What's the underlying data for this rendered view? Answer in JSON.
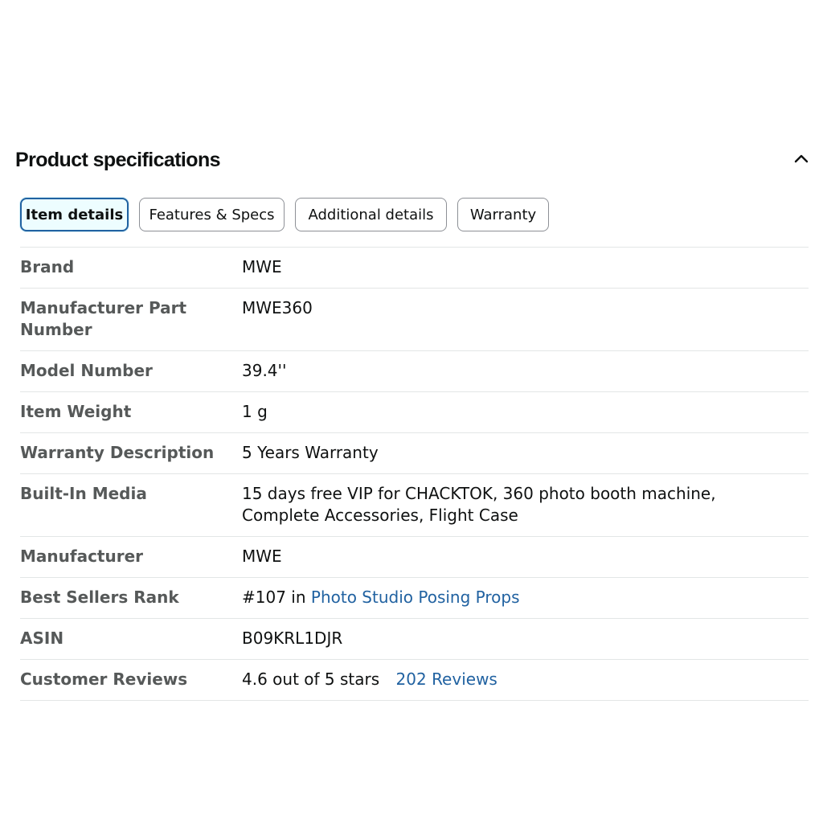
{
  "header": {
    "title": "Product specifications"
  },
  "icons": {
    "collapse": "chevron-up-icon"
  },
  "tabs": [
    {
      "label": "Item details",
      "active": true
    },
    {
      "label": "Features & Specs",
      "active": false
    },
    {
      "label": "Additional details",
      "active": false
    },
    {
      "label": "Warranty",
      "active": false
    }
  ],
  "specs": {
    "brand": {
      "label": "Brand",
      "value": "MWE"
    },
    "part_number": {
      "label": "Manufacturer Part Number",
      "value": "MWE360"
    },
    "model_number": {
      "label": "Model Number",
      "value": "39.4''"
    },
    "item_weight": {
      "label": "Item Weight",
      "value": "1 g"
    },
    "warranty": {
      "label": "Warranty Description",
      "value": "5 Years Warranty"
    },
    "built_in_media": {
      "label": "Built-In Media",
      "value": "15 days free VIP for CHACKTOK, 360 photo booth machine, Complete Accessories, Flight Case"
    },
    "manufacturer": {
      "label": "Manufacturer",
      "value": "MWE"
    },
    "best_sellers_rank": {
      "label": "Best Sellers Rank",
      "rank": "#107 in",
      "category": "Photo Studio Posing Props"
    },
    "asin": {
      "label": "ASIN",
      "value": "B09KRL1DJR"
    },
    "customer_reviews": {
      "label": "Customer Reviews",
      "rating": "4.6 out of 5 stars",
      "reviews_count": "202",
      "reviews_word": "Reviews"
    }
  },
  "colors": {
    "link": "#2162a1",
    "active_tab_border": "#2162a1",
    "active_tab_bg": "#edfdff",
    "label_text": "#565959",
    "divider": "#e3e6e6"
  }
}
